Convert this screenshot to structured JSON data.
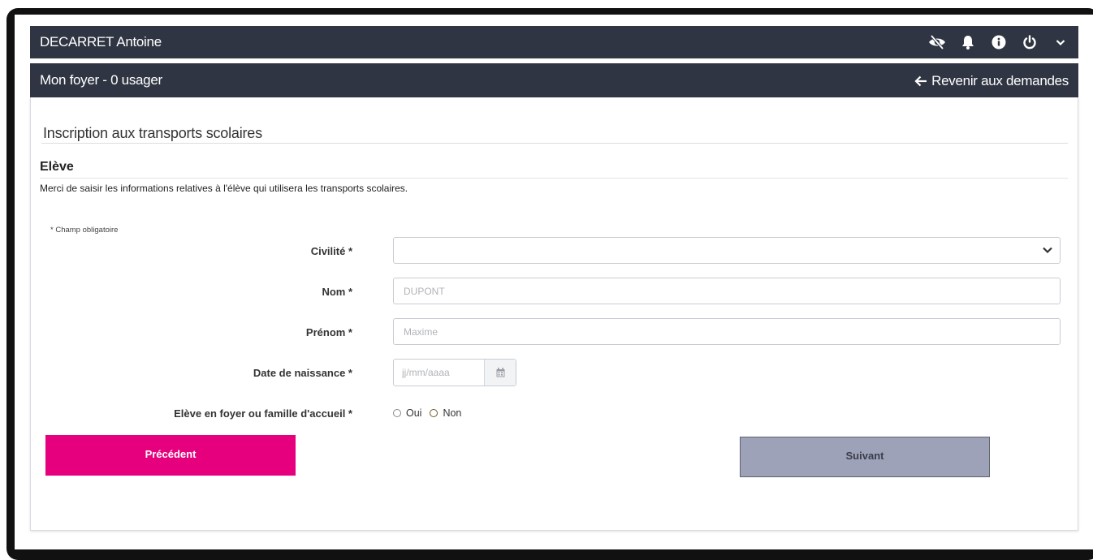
{
  "header": {
    "user_name": "DECARRET Antoine",
    "icons": [
      "eye-slash-icon",
      "bell-icon",
      "info-icon",
      "power-icon",
      "chevron-down-icon"
    ]
  },
  "subheader": {
    "title": "Mon foyer - 0 usager",
    "back_link": "Revenir aux demandes"
  },
  "page": {
    "title": "Inscription aux transports scolaires",
    "section_title": "Elève",
    "intro": "Merci de saisir les informations relatives à l'élève qui utilisera les transports scolaires.",
    "required_note": "* Champ obligatoire"
  },
  "form": {
    "civilite": {
      "label": "Civilité *",
      "value": ""
    },
    "nom": {
      "label": "Nom *",
      "placeholder": "DUPONT"
    },
    "prenom": {
      "label": "Prénom *",
      "placeholder": "Maxime"
    },
    "date_naissance": {
      "label": "Date de naissance *",
      "placeholder": "jj/mm/aaaa"
    },
    "foyer": {
      "label": "Elève en foyer ou famille d'accueil *",
      "option_oui": "Oui",
      "option_non": "Non"
    }
  },
  "buttons": {
    "previous": "Précédent",
    "next": "Suivant"
  },
  "colors": {
    "header_bg": "#2f3542",
    "primary_pink": "#e6007e",
    "next_button_bg": "#9ea2b8"
  }
}
